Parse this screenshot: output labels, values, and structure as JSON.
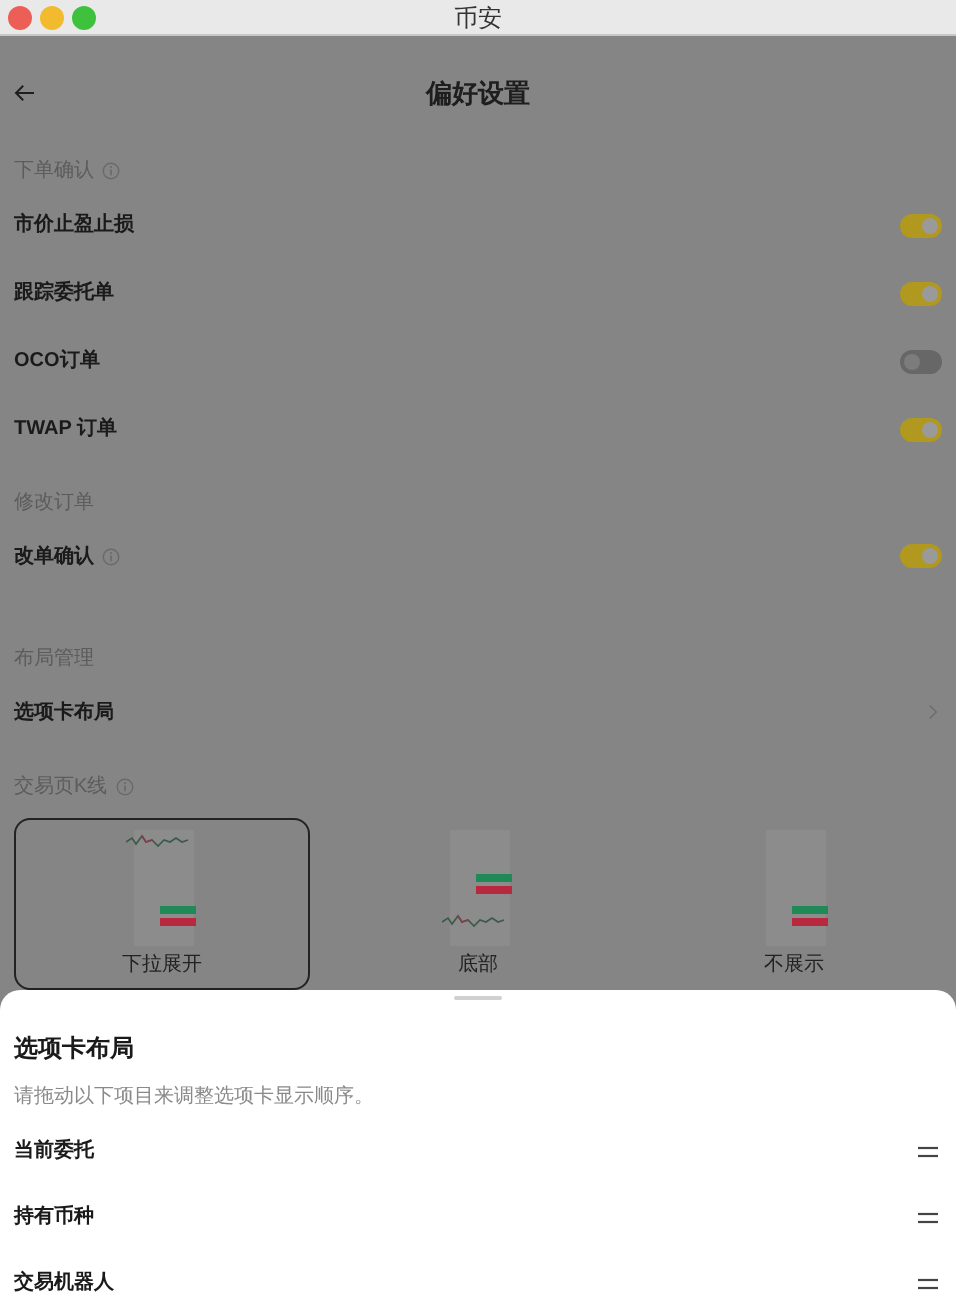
{
  "window": {
    "title": "币安"
  },
  "header": {
    "title": "偏好设置"
  },
  "sections": [
    {
      "title": "下单确认",
      "info": true,
      "rows": [
        {
          "kind": "toggle",
          "label": "市价止盈止损",
          "info": false,
          "on": true
        },
        {
          "kind": "toggle",
          "label": "跟踪委托单",
          "info": false,
          "on": true
        },
        {
          "kind": "toggle",
          "label": "OCO订单",
          "info": false,
          "on": false
        },
        {
          "kind": "toggle",
          "label": "TWAP 订单",
          "info": false,
          "on": true
        }
      ]
    },
    {
      "title": "修改订单",
      "info": false,
      "rows": [
        {
          "kind": "toggle",
          "label": "改单确认",
          "info": true,
          "on": true
        }
      ]
    },
    {
      "title": "布局管理",
      "info": false,
      "rows": [
        {
          "kind": "link",
          "label": "选项卡布局",
          "info": false
        }
      ]
    },
    {
      "title": "交易页K线",
      "info": true
    }
  ],
  "kline_options": [
    {
      "kind": "top",
      "label": "下拉展开",
      "selected": true
    },
    {
      "kind": "bottom",
      "label": "底部",
      "selected": false
    },
    {
      "kind": "none",
      "label": "不展示",
      "selected": false
    }
  ],
  "sheet": {
    "title": "选项卡布局",
    "description": "请拖动以下项目来调整选项卡显示顺序。",
    "items": [
      {
        "label": "当前委托"
      },
      {
        "label": "持有币种"
      },
      {
        "label": "交易机器人"
      }
    ]
  }
}
